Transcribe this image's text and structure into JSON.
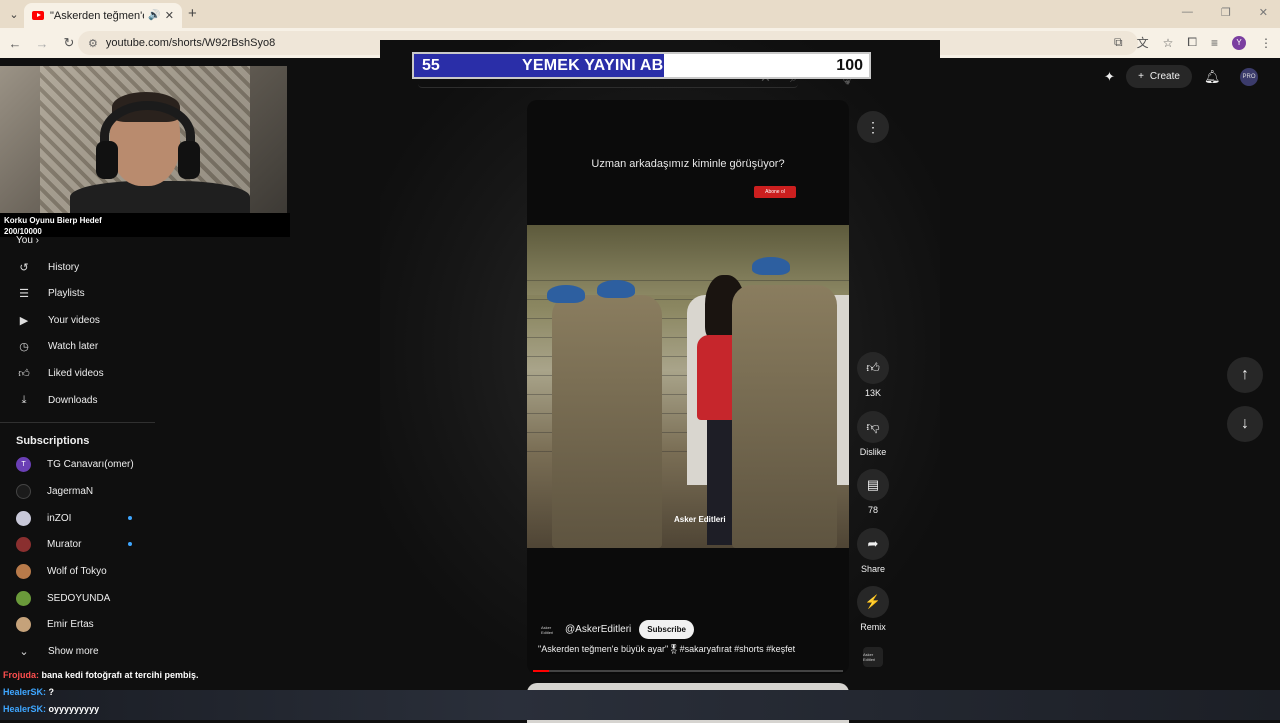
{
  "browser": {
    "tab_title": "\"Askerden teğmen'e büyük",
    "url": "youtube.com/shorts/W92rBshSyo8",
    "profile_initial": "Y"
  },
  "stream_overlay": {
    "goal_line1": "Korku Oyunu Bierp Hedef",
    "goal_line2": "200/10000",
    "sub_goal": {
      "current": "55",
      "title": "YEMEK YAYINI ABONE HEDEFİ",
      "max": "100",
      "progress_fraction": 0.55
    }
  },
  "header": {
    "create_label": "Create",
    "avatar_text": "PRO"
  },
  "sidebar": {
    "you_label": "You",
    "items": [
      {
        "label": "History",
        "icon": "history-icon"
      },
      {
        "label": "Playlists",
        "icon": "playlists-icon"
      },
      {
        "label": "Your videos",
        "icon": "your-videos-icon"
      },
      {
        "label": "Watch later",
        "icon": "watch-later-icon"
      },
      {
        "label": "Liked videos",
        "icon": "liked-icon"
      },
      {
        "label": "Downloads",
        "icon": "download-icon"
      }
    ],
    "subscriptions_heading": "Subscriptions",
    "subscriptions": [
      {
        "label": "TG Canavarı(omer)",
        "initial": "T",
        "color": "#6a3fb5",
        "new": false
      },
      {
        "label": "JagermaN",
        "initial": "",
        "color": "#1b1b1b",
        "new": false
      },
      {
        "label": "inZOI",
        "initial": "",
        "color": "#c8c8d8",
        "new": true
      },
      {
        "label": "Murator",
        "initial": "",
        "color": "#8a2f2f",
        "new": true
      },
      {
        "label": "Wolf of Tokyo",
        "initial": "",
        "color": "#b87a4a",
        "new": false
      },
      {
        "label": "SEDOYUNDA",
        "initial": "",
        "color": "#6a9a3a",
        "new": false
      },
      {
        "label": "Emir Ertas",
        "initial": "",
        "color": "#c5a27a",
        "new": false
      }
    ],
    "show_more": "Show more"
  },
  "short": {
    "caption": "Uzman arkadaşımız kiminle görüşüyor?",
    "abone_label": "Abone ol",
    "watermark": "Asker Editleri",
    "channel": "@AskerEditleri",
    "channel_avatar_text": "Asker Editleri",
    "subscribe_label": "Subscribe",
    "description": "\"Askerden teğmen'e büyük ayar\"🎖#sakaryafırat #shorts #keşfet",
    "progress_fraction": 0.05
  },
  "actions": {
    "like_count": "13K",
    "dislike_label": "Dislike",
    "comments_count": "78",
    "share_label": "Share",
    "remix_label": "Remix",
    "thumb_text": "Asker Editleri"
  },
  "chat": [
    {
      "user": "Frojuda:",
      "message": " bana kedi fotoğrafı at tercihi pembiş."
    },
    {
      "user": "HealerSK:",
      "message": " ?"
    },
    {
      "user": "HealerSK:",
      "message": " oyyyyyyyyy"
    }
  ]
}
